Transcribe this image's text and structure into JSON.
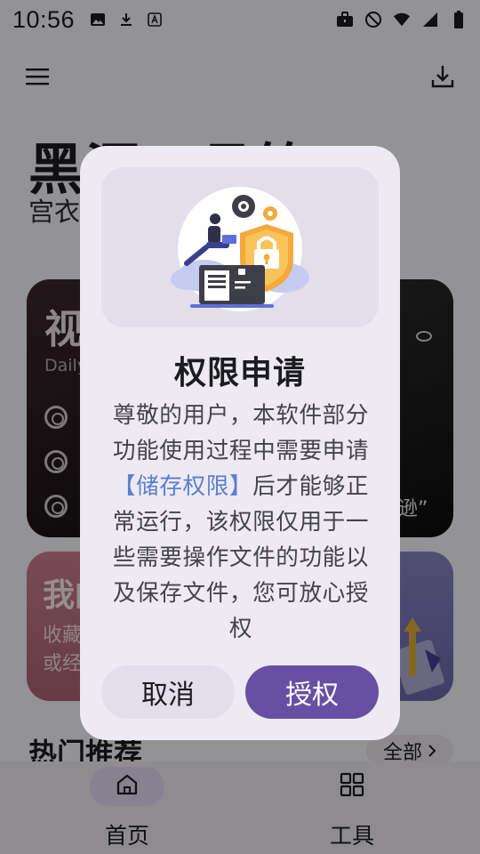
{
  "status_bar": {
    "time": "10:56",
    "left_icons": [
      "image-icon",
      "download-icon",
      "font-icon"
    ],
    "right_icons": [
      "briefcase-icon",
      "mute-icon",
      "wifi-icon",
      "signal-icon",
      "battery-icon"
    ]
  },
  "top_bar": {
    "menu_icon": "menu-icon",
    "download_icon": "download-icon"
  },
  "hero": {
    "title": "黑洞工具箱",
    "subtitle": "宫衣"
  },
  "cards": {
    "video": {
      "title": "视",
      "subtitle": "Daily"
    },
    "dark_right": {
      "quote": "逊”"
    },
    "mine": {
      "title": "我的",
      "line1": "收藏",
      "line2": "或经"
    }
  },
  "section": {
    "title": "热门推荐",
    "all_label": "全部"
  },
  "bottom_nav": {
    "items": [
      {
        "label": "首页",
        "icon": "home-icon",
        "selected": true
      },
      {
        "label": "工具",
        "icon": "grid-icon",
        "selected": false
      }
    ]
  },
  "dialog": {
    "title": "权限申请",
    "body_before": "尊敬的用户，本软件部分功能使用过程中需要申请",
    "body_highlight": "【储存权限】",
    "body_after": "后才能够正常运行，该权限仅用于一些需要操作文件的功能以及保存文件，您可放心授权",
    "cancel_label": "取消",
    "confirm_label": "授权",
    "illustration": "security-lock-illustration",
    "colors": {
      "accent": "#6750a4",
      "highlight": "#5a7fd0",
      "surface": "#eeeaf3"
    }
  }
}
